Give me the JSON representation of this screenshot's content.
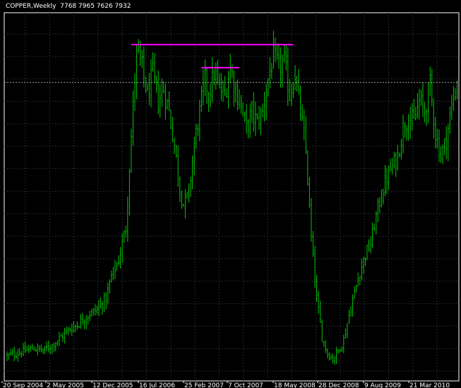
{
  "chart_data": {
    "type": "bar",
    "symbol": "COPPER",
    "timeframe": "Weekly",
    "title": "COPPER,Weekly",
    "ohlc_label": "7768 7965 7626 7932",
    "x_tick_labels": [
      "20 Sep 2004",
      "2 May 2005",
      "12 Dec 2005",
      "16 Jul 2006",
      "25 Feb 2007",
      "7 Oct 2007",
      "18 May 2008",
      "28 Dec 2008",
      "9 Aug 2009",
      "21 Mar 2010"
    ],
    "price_line": 7932,
    "ylim": [
      2500,
      9200
    ],
    "grid": true,
    "anchors": [
      [
        0,
        2950
      ],
      [
        5,
        3000
      ],
      [
        10,
        3050
      ],
      [
        15,
        3100
      ],
      [
        20,
        3050
      ],
      [
        25,
        3150
      ],
      [
        30,
        3300
      ],
      [
        35,
        3450
      ],
      [
        40,
        3550
      ],
      [
        45,
        3700
      ],
      [
        50,
        3800
      ],
      [
        55,
        4000
      ],
      [
        58,
        4400
      ],
      [
        62,
        4700
      ],
      [
        66,
        5300
      ],
      [
        68,
        6400
      ],
      [
        70,
        7500
      ],
      [
        72,
        8500
      ],
      [
        75,
        8200
      ],
      [
        78,
        7700
      ],
      [
        81,
        8100
      ],
      [
        84,
        7600
      ],
      [
        87,
        7800
      ],
      [
        90,
        7400
      ],
      [
        93,
        6800
      ],
      [
        96,
        6000
      ],
      [
        98,
        5700
      ],
      [
        101,
        5900
      ],
      [
        104,
        6800
      ],
      [
        107,
        7400
      ],
      [
        110,
        8000
      ],
      [
        112,
        7700
      ],
      [
        115,
        8100
      ],
      [
        118,
        7800
      ],
      [
        121,
        7700
      ],
      [
        124,
        8200
      ],
      [
        127,
        7800
      ],
      [
        130,
        7500
      ],
      [
        133,
        7100
      ],
      [
        136,
        7400
      ],
      [
        139,
        7200
      ],
      [
        142,
        7400
      ],
      [
        145,
        8000
      ],
      [
        148,
        8400
      ],
      [
        151,
        8200
      ],
      [
        154,
        8300
      ],
      [
        157,
        7700
      ],
      [
        160,
        8100
      ],
      [
        163,
        7400
      ],
      [
        166,
        6700
      ],
      [
        169,
        5100
      ],
      [
        172,
        4000
      ],
      [
        175,
        3300
      ],
      [
        178,
        3000
      ],
      [
        181,
        2900
      ],
      [
        184,
        3050
      ],
      [
        187,
        3250
      ],
      [
        190,
        3700
      ],
      [
        193,
        4100
      ],
      [
        196,
        4500
      ],
      [
        199,
        4800
      ],
      [
        202,
        5000
      ],
      [
        205,
        5500
      ],
      [
        208,
        5900
      ],
      [
        211,
        6200
      ],
      [
        214,
        6400
      ],
      [
        217,
        6600
      ],
      [
        220,
        7100
      ],
      [
        223,
        7300
      ],
      [
        226,
        7200
      ],
      [
        229,
        7600
      ],
      [
        232,
        7400
      ],
      [
        235,
        7900
      ],
      [
        238,
        7000
      ],
      [
        241,
        6600
      ],
      [
        244,
        6900
      ],
      [
        247,
        7500
      ],
      [
        250,
        7900
      ]
    ],
    "resistance_lines": [
      {
        "x_start": 69,
        "x_end": 159,
        "value": 8620
      },
      {
        "x_start": 108,
        "x_end": 129,
        "value": 8200
      }
    ]
  }
}
